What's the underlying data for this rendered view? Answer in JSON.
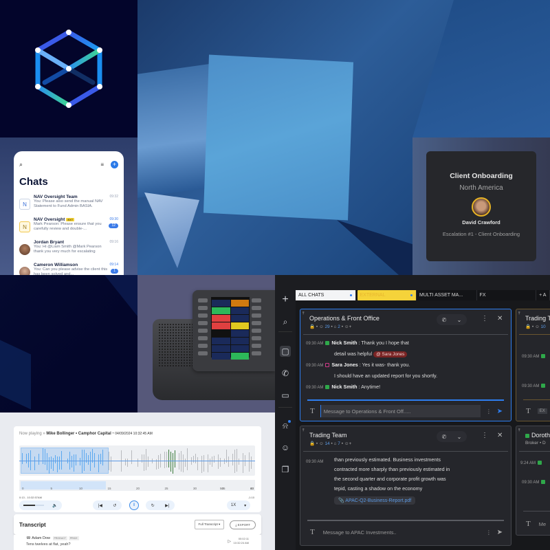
{
  "mobile_chats": {
    "title": "Chats",
    "icons": {
      "search": "search-icon",
      "filter": "filter-icon",
      "new_chat": "plus-circle-icon"
    },
    "items": [
      {
        "avatar_letter": "N",
        "name": "NAV Oversight Team",
        "time": "09:32",
        "preview": "You: Please also send the manual NAV Statement to Fund Admin BASIA.",
        "badge": null,
        "tag": null
      },
      {
        "avatar_letter": "N",
        "name": "NAV Oversight",
        "time": "09:30",
        "preview": "Mark Pearson: Please ensure that you carefully review and double-...",
        "badge": "12",
        "tag": "EXT"
      },
      {
        "avatar_letter": "",
        "name": "Jordan Bryant",
        "time": "09:16",
        "preview": "You: Hi @Liam Smith @Mark Pearson thank you very much for escalating",
        "badge": null,
        "tag": null
      },
      {
        "avatar_letter": "",
        "name": "Cameron Williamson",
        "time": "09:14",
        "preview": "You: Can you please advise the client this has been solved and...",
        "badge": "1",
        "tag": null
      }
    ]
  },
  "onboarding": {
    "title": "Client Onboarding",
    "region": "North America",
    "name": "David Crawford",
    "escalation": "Escalation #1 - Client Onboarding"
  },
  "player": {
    "now_playing_label": "Now playing",
    "now_playing_caller": "Mike Bollinger • Camphor Capital",
    "now_playing_date": "04/09/2024 10:32:45 AM",
    "ticks": [
      "0",
      "5",
      "10",
      "15",
      "20",
      "25",
      "30",
      "35",
      "40",
      "50",
      "60"
    ],
    "current": "0:13 - 10:32:57AM",
    "remaining": "-1:10",
    "volume": 0.55,
    "progress": 0.37,
    "speed": "1X",
    "transcript_title": "Transcript",
    "transcript_filter": "Full Transcript",
    "export_label": "EXPORT",
    "row": {
      "speaker": "Adam Dow",
      "tags": [
        "PRODUCT",
        "PRICE"
      ],
      "text": "Tens twelves at flat, yeah?",
      "offset": "00:02:11",
      "clock": "10:32:24 AM"
    }
  },
  "desktop": {
    "sidebar": [
      "plus-icon",
      "search-icon",
      "chat-icon",
      "phone-icon",
      "video-icon",
      "bell-icon",
      "contacts-icon",
      "bookmark-icon"
    ],
    "tabs": [
      {
        "label": "ALL CHATS",
        "dot": true
      },
      {
        "label": "EXTERNAL",
        "dot": true
      },
      {
        "label": "MULTI ASSET MA...",
        "dot": false
      },
      {
        "label": "FX",
        "dot": false
      },
      {
        "label": "+ A",
        "dot": false
      }
    ],
    "panel1": {
      "title": "Operations & Front Office",
      "members": "29",
      "bots": "2",
      "messages": [
        {
          "time": "09:30 AM",
          "sender": "Nick Smith",
          "text": "Thank you I hope that",
          "cont": "detail was helpful",
          "mention": "@ Sara Jones"
        },
        {
          "time": "09:30 AM",
          "sender": "Sara Jones",
          "text": "Yes it was- thank you.",
          "cont": "I should have an updated report for you shortly."
        },
        {
          "time": "09:30 AM",
          "sender": "Nick Smith",
          "text": "Anytime!"
        }
      ],
      "placeholder": "Message to Operations & Front Off....."
    },
    "panel2": {
      "title": "Trading Team",
      "members": "14",
      "bots": "7",
      "time": "09:30 AM",
      "lines": [
        "than previously estimated. Business investments",
        "contracted more sharply than previously estimated in",
        "the second quarter and corporate profit growth was",
        "tepid, casting a shadow on the economy"
      ],
      "attachment": "APAC-Q2-Business-Report.pdf",
      "placeholder": "Message to APAC Investments.."
    },
    "panel3": {
      "title": "Trading T",
      "members": "10",
      "times": [
        "09:30 AM",
        "09:30 AM"
      ],
      "badge": "EX"
    },
    "panel4": {
      "title": "Doroth",
      "sub": "Broker • D",
      "times": [
        "9:24 AM",
        "09:30 AM"
      ],
      "placeholder": "Me"
    }
  }
}
